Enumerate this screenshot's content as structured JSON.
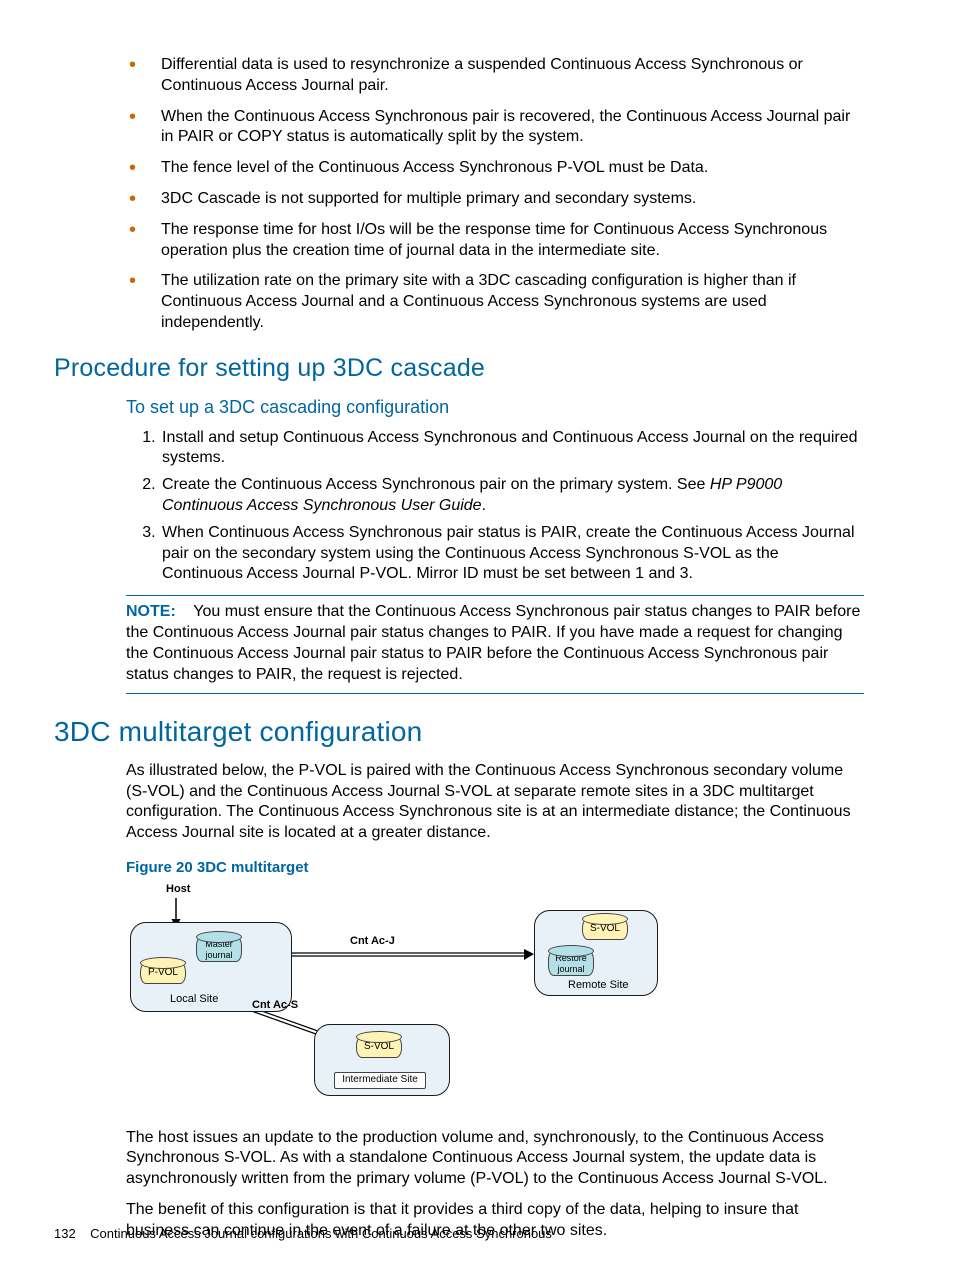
{
  "bullets": [
    "Differential data is used to resynchronize a suspended Continuous Access Synchronous or Continuous Access Journal pair.",
    "When the Continuous Access Synchronous pair is recovered, the Continuous Access Journal pair in PAIR or COPY status is automatically split by the system.",
    "The fence level of the Continuous Access Synchronous P-VOL must be Data.",
    "3DC Cascade is not supported for multiple primary and secondary systems.",
    "The response time for host I/Os will be the response time for Continuous Access Synchronous operation plus the creation time of journal data in the intermediate site.",
    "The utilization rate on the primary site with a 3DC cascading configuration is higher than if Continuous Access Journal and a Continuous Access Synchronous systems are used independently."
  ],
  "h2_procedure": "Procedure for setting up 3DC cascade",
  "h3_setup": "To set up a 3DC cascading configuration",
  "steps": [
    "Install and setup Continuous Access Synchronous and Continuous Access Journal on the required systems.",
    {
      "pre": "Create the Continuous Access Synchronous pair on the primary system. See ",
      "ital": "HP P9000 Continuous Access Synchronous User Guide",
      "post": "."
    },
    "When Continuous Access Synchronous pair status is PAIR, create the Continuous Access Journal pair on the secondary system using the Continuous Access Synchronous S-VOL as the Continuous Access Journal P-VOL. Mirror ID must be set between 1 and 3."
  ],
  "note_label": "NOTE:",
  "note_body": "You must ensure that the Continuous Access Synchronous pair status changes to PAIR before the Continuous Access Journal pair status changes to PAIR. If you have made a request for changing the Continuous Access Journal pair status to PAIR before the Continuous Access Synchronous pair status changes to PAIR, the request is rejected.",
  "h1_multi": "3DC multitarget configuration",
  "multi_p1": "As illustrated below, the P-VOL is paired with the Continuous Access Synchronous secondary volume (S-VOL) and the Continuous Access Journal S-VOL at separate remote sites in a 3DC multitarget configuration. The Continuous Access Synchronous site is at an intermediate distance; the Continuous Access Journal site is located at a greater distance.",
  "fig_title": "Figure 20 3DC multitarget",
  "diagram": {
    "host": "Host",
    "master_journal": "Master journal",
    "restore_journal": "Restore journal",
    "pvol": "P-VOL",
    "svol": "S-VOL",
    "local_site": "Local Site",
    "remote_site": "Remote Site",
    "intermediate_site": "Intermediate Site",
    "cnt_acj": "Cnt Ac-J",
    "cnt_acs": "Cnt Ac-S"
  },
  "multi_p2": "The host issues an update to the production volume and, synchronously, to the Continuous Access Synchronous S-VOL. As with a standalone Continuous Access Journal system, the update data is asynchronously written from the primary volume (P-VOL) to the Continuous Access Journal S-VOL.",
  "multi_p3": "The benefit of this configuration is that it provides a third copy of the data, helping to insure that business can continue in the event of a failure at the other two sites.",
  "footer_page": "132",
  "footer_text": "Continuous Access Journal configurations with Continuous Access Synchronous"
}
